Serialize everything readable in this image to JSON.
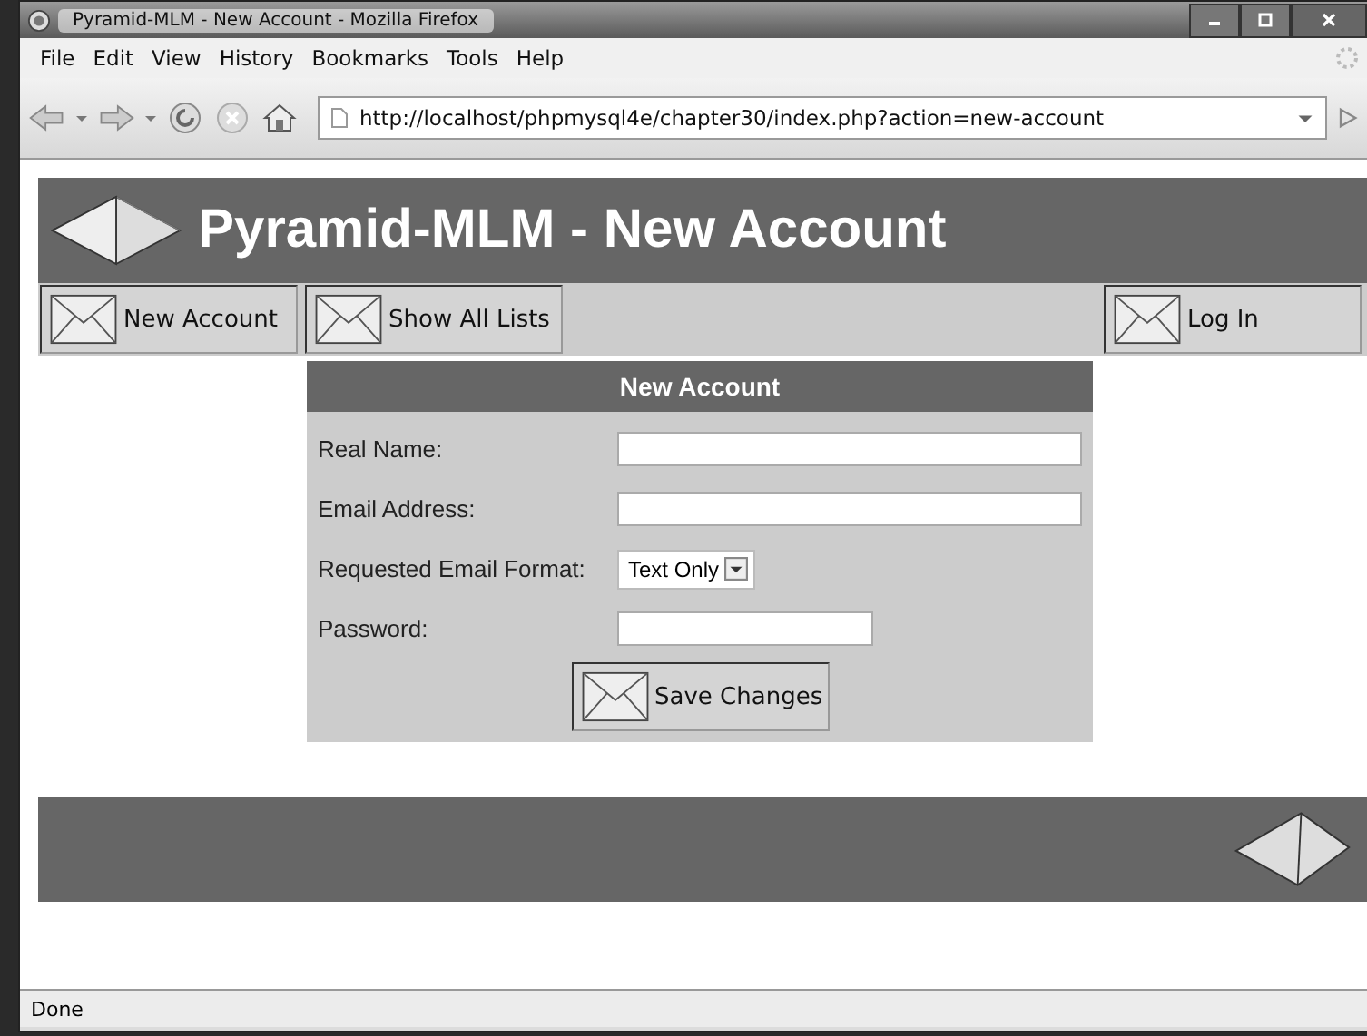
{
  "window": {
    "title": "Pyramid-MLM - New Account - Mozilla Firefox"
  },
  "menu": [
    "File",
    "Edit",
    "View",
    "History",
    "Bookmarks",
    "Tools",
    "Help"
  ],
  "address_bar": {
    "url": "http://localhost/phpmysql4e/chapter30/index.php?action=new-account"
  },
  "page": {
    "header": {
      "title": "Pyramid-MLM - New Account"
    },
    "nav_left": [
      {
        "label": "New Account"
      },
      {
        "label": "Show All Lists"
      }
    ],
    "nav_right": [
      {
        "label": "Log In"
      }
    ],
    "form": {
      "title": "New Account",
      "fields": [
        {
          "kind": "text",
          "label": "Real Name:"
        },
        {
          "kind": "text",
          "label": "Email Address:"
        },
        {
          "kind": "select",
          "label": "Requested Email Format:",
          "value": "Text Only"
        },
        {
          "kind": "password",
          "label": "Password:"
        }
      ],
      "submit": "Save Changes"
    }
  },
  "status_bar": {
    "text": "Done"
  }
}
